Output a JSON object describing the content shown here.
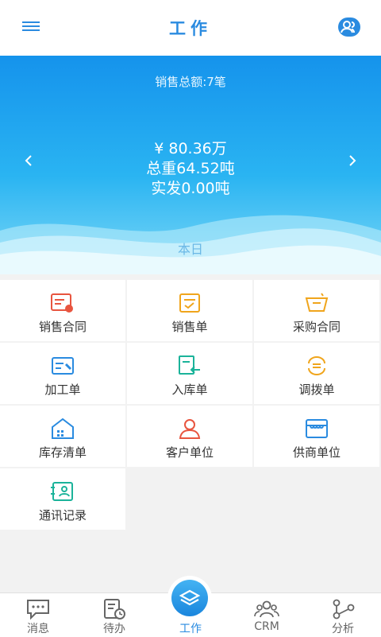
{
  "header": {
    "title": "工作"
  },
  "banner": {
    "summary": "销售总额:7笔",
    "amount": "¥ 80.36万",
    "weight": "总重64.52吨",
    "shipped": "实发0.00吨",
    "period": "本日"
  },
  "grid": {
    "items": [
      {
        "label": "销售合同",
        "icon": "sales-contract-icon",
        "color": "#e8553f"
      },
      {
        "label": "销售单",
        "icon": "sales-order-icon",
        "color": "#f0a51c"
      },
      {
        "label": "采购合同",
        "icon": "purchase-contract-icon",
        "color": "#f0a51c"
      },
      {
        "label": "加工单",
        "icon": "processing-order-icon",
        "color": "#2a8be0"
      },
      {
        "label": "入库单",
        "icon": "warehouse-in-icon",
        "color": "#1bb39a"
      },
      {
        "label": "调拨单",
        "icon": "transfer-order-icon",
        "color": "#f0a51c"
      },
      {
        "label": "库存清单",
        "icon": "inventory-icon",
        "color": "#2a8be0"
      },
      {
        "label": "客户单位",
        "icon": "customer-icon",
        "color": "#e8553f"
      },
      {
        "label": "供商单位",
        "icon": "supplier-icon",
        "color": "#2a8be0"
      },
      {
        "label": "通讯记录",
        "icon": "contacts-icon",
        "color": "#1bb39a"
      }
    ]
  },
  "tabs": [
    {
      "label": "消息",
      "icon": "message-icon"
    },
    {
      "label": "待办",
      "icon": "todo-icon"
    },
    {
      "label": "工作",
      "icon": "work-icon",
      "active": true
    },
    {
      "label": "CRM",
      "icon": "crm-icon"
    },
    {
      "label": "分析",
      "icon": "analysis-icon"
    }
  ],
  "colors": {
    "accent": "#2a8be0"
  }
}
